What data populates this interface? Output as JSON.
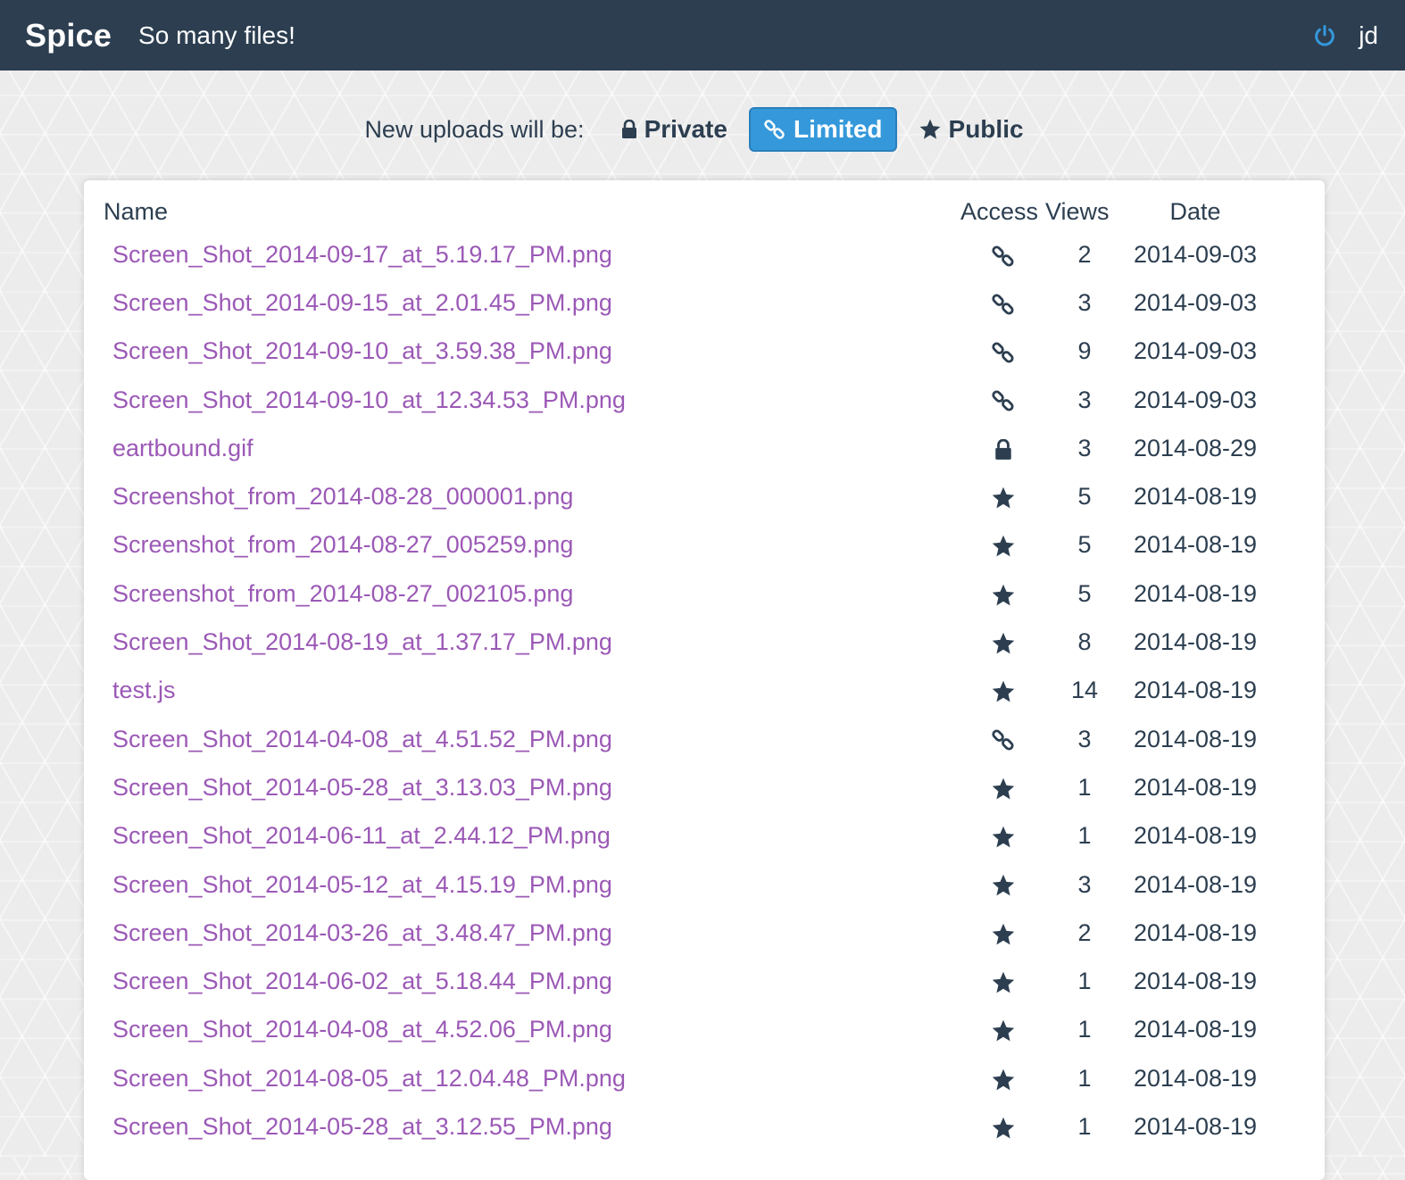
{
  "header": {
    "brand": "Spice",
    "tagline": "So many files!",
    "power_icon": "power-icon",
    "user": "jd"
  },
  "uploads": {
    "label": "New uploads will be:",
    "options": [
      {
        "label": "Private",
        "icon": "lock-icon",
        "active": false
      },
      {
        "label": "Limited",
        "icon": "link-icon",
        "active": true
      },
      {
        "label": "Public",
        "icon": "star-icon",
        "active": false
      }
    ]
  },
  "table": {
    "headers": {
      "name": "Name",
      "access": "Access",
      "views": "Views",
      "date": "Date"
    },
    "rows": [
      {
        "name": "Screen_Shot_2014-09-17_at_5.19.17_PM.png",
        "access": "link",
        "views": "2",
        "date": "2014-09-03"
      },
      {
        "name": "Screen_Shot_2014-09-15_at_2.01.45_PM.png",
        "access": "link",
        "views": "3",
        "date": "2014-09-03"
      },
      {
        "name": "Screen_Shot_2014-09-10_at_3.59.38_PM.png",
        "access": "link",
        "views": "9",
        "date": "2014-09-03"
      },
      {
        "name": "Screen_Shot_2014-09-10_at_12.34.53_PM.png",
        "access": "link",
        "views": "3",
        "date": "2014-09-03"
      },
      {
        "name": "eartbound.gif",
        "access": "lock",
        "views": "3",
        "date": "2014-08-29"
      },
      {
        "name": "Screenshot_from_2014-08-28_000001.png",
        "access": "star",
        "views": "5",
        "date": "2014-08-19"
      },
      {
        "name": "Screenshot_from_2014-08-27_005259.png",
        "access": "star",
        "views": "5",
        "date": "2014-08-19"
      },
      {
        "name": "Screenshot_from_2014-08-27_002105.png",
        "access": "star",
        "views": "5",
        "date": "2014-08-19"
      },
      {
        "name": "Screen_Shot_2014-08-19_at_1.37.17_PM.png",
        "access": "star",
        "views": "8",
        "date": "2014-08-19"
      },
      {
        "name": "test.js",
        "access": "star",
        "views": "14",
        "date": "2014-08-19"
      },
      {
        "name": "Screen_Shot_2014-04-08_at_4.51.52_PM.png",
        "access": "link",
        "views": "3",
        "date": "2014-08-19"
      },
      {
        "name": "Screen_Shot_2014-05-28_at_3.13.03_PM.png",
        "access": "star",
        "views": "1",
        "date": "2014-08-19"
      },
      {
        "name": "Screen_Shot_2014-06-11_at_2.44.12_PM.png",
        "access": "star",
        "views": "1",
        "date": "2014-08-19"
      },
      {
        "name": "Screen_Shot_2014-05-12_at_4.15.19_PM.png",
        "access": "star",
        "views": "3",
        "date": "2014-08-19"
      },
      {
        "name": "Screen_Shot_2014-03-26_at_3.48.47_PM.png",
        "access": "star",
        "views": "2",
        "date": "2014-08-19"
      },
      {
        "name": "Screen_Shot_2014-06-02_at_5.18.44_PM.png",
        "access": "star",
        "views": "1",
        "date": "2014-08-19"
      },
      {
        "name": "Screen_Shot_2014-04-08_at_4.52.06_PM.png",
        "access": "star",
        "views": "1",
        "date": "2014-08-19"
      },
      {
        "name": "Screen_Shot_2014-08-05_at_12.04.48_PM.png",
        "access": "star",
        "views": "1",
        "date": "2014-08-19"
      },
      {
        "name": "Screen_Shot_2014-05-28_at_3.12.55_PM.png",
        "access": "star",
        "views": "1",
        "date": "2014-08-19"
      }
    ]
  },
  "colors": {
    "navbar": "#2c3e50",
    "accent": "#3498db",
    "link": "#9b59b6",
    "text": "#2c3e50"
  }
}
